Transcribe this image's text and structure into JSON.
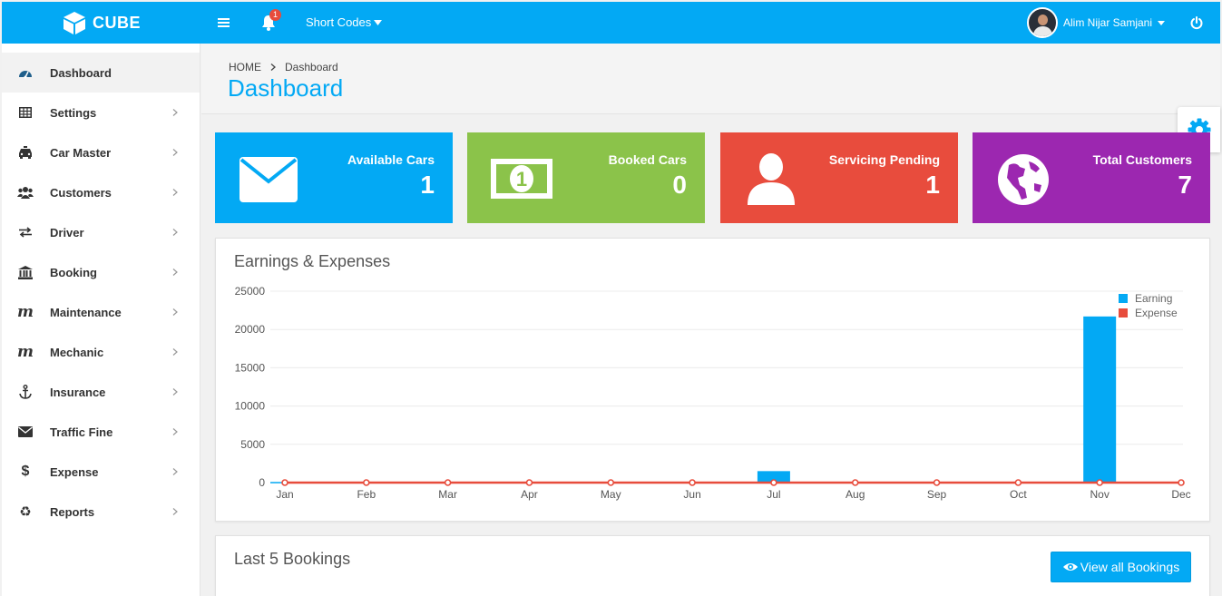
{
  "brand": {
    "name": "CUBE"
  },
  "topbar": {
    "notification_count": "1",
    "shortcodes_label": "Short Codes",
    "user_name": "Alim Nijar Samjani"
  },
  "sidebar": {
    "items": [
      {
        "label": "Dashboard",
        "icon": "dashboard-icon",
        "active": true
      },
      {
        "label": "Settings",
        "icon": "table-icon"
      },
      {
        "label": "Car Master",
        "icon": "taxi-icon"
      },
      {
        "label": "Customers",
        "icon": "users-icon"
      },
      {
        "label": "Driver",
        "icon": "exchange-icon"
      },
      {
        "label": "Booking",
        "icon": "bank-icon"
      },
      {
        "label": "Maintenance",
        "icon": "maintenance-icon"
      },
      {
        "label": "Mechanic",
        "icon": "mechanic-icon"
      },
      {
        "label": "Insurance",
        "icon": "anchor-icon"
      },
      {
        "label": "Traffic Fine",
        "icon": "envelope-icon"
      },
      {
        "label": "Expense",
        "icon": "dollar-icon"
      },
      {
        "label": "Reports",
        "icon": "recycle-icon"
      }
    ]
  },
  "header": {
    "breadcrumb_home": "HOME",
    "breadcrumb_current": "Dashboard",
    "title": "Dashboard"
  },
  "stats": [
    {
      "title": "Available Cars",
      "value": "1",
      "color": "#03a9f4",
      "icon": "envelope-icon"
    },
    {
      "title": "Booked Cars",
      "value": "0",
      "color": "#8bc34a",
      "icon": "money-icon"
    },
    {
      "title": "Servicing Pending",
      "value": "1",
      "color": "#e84c3d",
      "icon": "user-icon"
    },
    {
      "title": "Total Customers",
      "value": "7",
      "color": "#9c27b0",
      "icon": "globe-icon"
    }
  ],
  "earnings_panel": {
    "title": "Earnings & Expenses"
  },
  "bookings_panel": {
    "title": "Last 5 Bookings",
    "button_label": "View all Bookings"
  },
  "chart_data": {
    "type": "bar",
    "categories": [
      "Jan",
      "Feb",
      "Mar",
      "Apr",
      "May",
      "Jun",
      "Jul",
      "Aug",
      "Sep",
      "Oct",
      "Nov",
      "Dec"
    ],
    "series": [
      {
        "name": "Earning",
        "type": "bar",
        "color": "#03a9f4",
        "values": [
          0,
          0,
          0,
          0,
          0,
          0,
          1500,
          0,
          0,
          0,
          21700,
          0
        ]
      },
      {
        "name": "Expense",
        "type": "line",
        "color": "#e74c3c",
        "values": [
          0,
          0,
          0,
          0,
          0,
          0,
          0,
          0,
          0,
          0,
          0,
          0
        ]
      }
    ],
    "yticks": [
      0,
      5000,
      10000,
      15000,
      20000,
      25000
    ],
    "ylim": [
      0,
      25000
    ],
    "legend": "top-right",
    "grid": true
  }
}
